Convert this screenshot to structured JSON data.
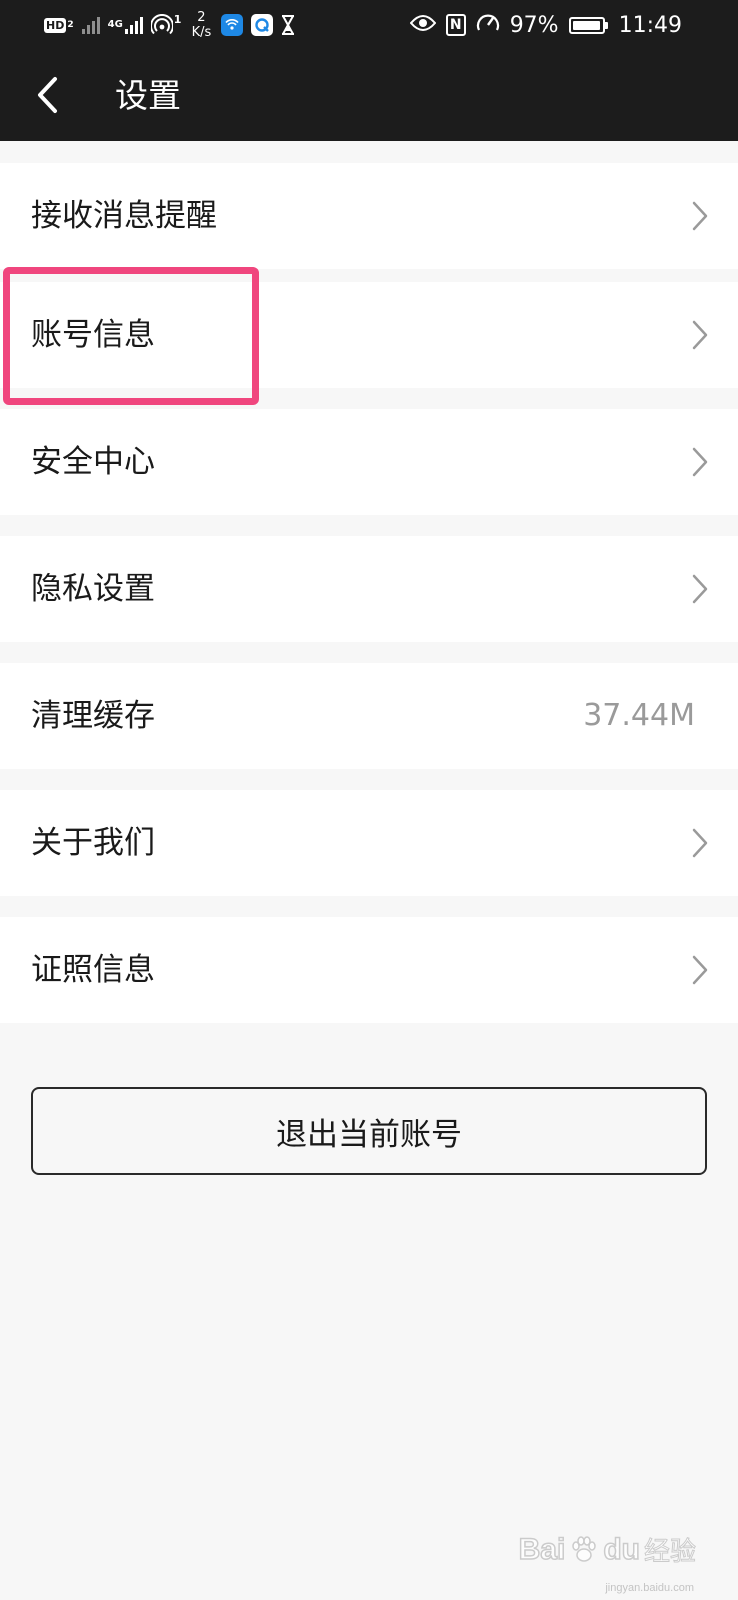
{
  "status_bar": {
    "hd_label": "HD",
    "hd_sub": "2",
    "net_label": "4G",
    "hotspot_count": "1",
    "speed_value": "2",
    "speed_unit": "K/s",
    "battery_percent": "97%",
    "battery_level": 0.97,
    "time": "11:49",
    "nfc_label": "N",
    "icons": [
      "hd-icon",
      "signal-no-sim-icon",
      "signal-4g-icon",
      "hotspot-icon",
      "app-wifi-icon",
      "app-browser-icon",
      "hourglass-icon",
      "eye-icon",
      "nfc-icon",
      "performance-icon",
      "battery-icon"
    ]
  },
  "header": {
    "back_icon": "chevron-left-icon",
    "title": "设置"
  },
  "settings": {
    "items": [
      {
        "label": "接收消息提醒",
        "chevron": "chevron-right-icon"
      },
      {
        "label": "账号信息",
        "chevron": "chevron-right-icon"
      },
      {
        "label": "安全中心",
        "chevron": "chevron-right-icon"
      },
      {
        "label": "隐私设置",
        "chevron": "chevron-right-icon"
      },
      {
        "label": "清理缓存",
        "value": "37.44M"
      },
      {
        "label": "关于我们",
        "chevron": "chevron-right-icon"
      },
      {
        "label": "证照信息",
        "chevron": "chevron-right-icon"
      }
    ]
  },
  "logout": {
    "label": "退出当前账号"
  },
  "watermark": {
    "brand": "Bai",
    "brand2": "du",
    "cn": "经验",
    "url": "jingyan.baidu.com"
  },
  "colors": {
    "header_bg": "#1c1c1c",
    "page_bg": "#f7f7f7",
    "highlight": "#f0467e",
    "value_text": "#9a9a9a"
  }
}
